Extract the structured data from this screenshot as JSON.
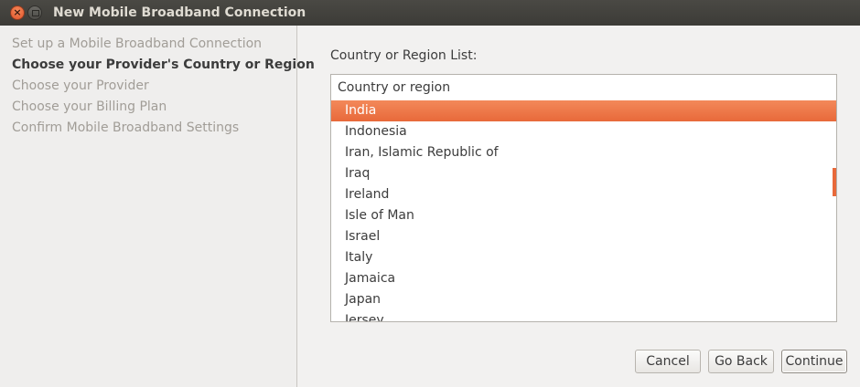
{
  "window": {
    "title": "New Mobile Broadband Connection",
    "close_glyph": "×"
  },
  "sidebar": {
    "steps": [
      {
        "label": "Set up a Mobile Broadband Connection",
        "current": false
      },
      {
        "label": "Choose your Provider's Country or Region",
        "current": true
      },
      {
        "label": "Choose your Provider",
        "current": false
      },
      {
        "label": "Choose your Billing Plan",
        "current": false
      },
      {
        "label": "Confirm Mobile Broadband Settings",
        "current": false
      }
    ]
  },
  "main": {
    "list_label": "Country or Region List:",
    "column_header": "Country or region",
    "selected_index": 0,
    "countries": [
      "India",
      "Indonesia",
      "Iran, Islamic Republic of",
      "Iraq",
      "Ireland",
      "Isle of Man",
      "Israel",
      "Italy",
      "Jamaica",
      "Japan",
      "Jersey"
    ]
  },
  "buttons": {
    "cancel": "Cancel",
    "go_back": "Go Back",
    "continue": "Continue"
  },
  "colors": {
    "accent": "#e8693a",
    "titlebar": "#3c3b37"
  }
}
